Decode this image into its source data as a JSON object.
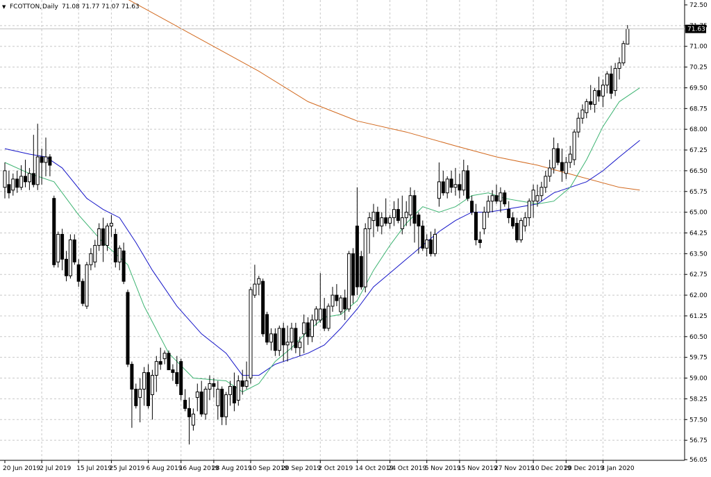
{
  "header": {
    "arrow": "▼",
    "symbol": "FCOTTON,",
    "timeframe": "Daily",
    "ohlc": "71.08 71.77 71.07 71.63"
  },
  "price_tag": "71.63",
  "colors": {
    "background": "#ffffff",
    "grid": "#c8c8c8",
    "bull_candle": "#ffffff",
    "bear_candle": "#000000",
    "candle_outline": "#000000",
    "ma_fast": "#3cb371",
    "ma_mid": "#1414c8",
    "ma_slow": "#d2691e",
    "price_tag_bg": "#000000",
    "price_tag_text": "#ffffff"
  },
  "chart_data": {
    "type": "candlestick",
    "title": "FCOTTON, Daily",
    "grid": true,
    "ylim": [
      56.05,
      72.5
    ],
    "y_ticks": [
      "72.50",
      "71.75",
      "71.00",
      "70.25",
      "69.50",
      "68.75",
      "68.00",
      "67.25",
      "66.50",
      "65.75",
      "65.00",
      "64.25",
      "63.50",
      "62.75",
      "62.00",
      "61.25",
      "60.50",
      "59.75",
      "59.00",
      "58.25",
      "57.50",
      "56.75",
      "56.05"
    ],
    "x_labels": [
      "20 Jun 2019",
      "2 Jul 2019",
      "15 Jul 2019",
      "25 Jul 2019",
      "6 Aug 2019",
      "16 Aug 2019",
      "28 Aug 2019",
      "10 Sep 2019",
      "20 Sep 2019",
      "2 Oct 2019",
      "14 Oct 2019",
      "24 Oct 2019",
      "5 Nov 2019",
      "15 Nov 2019",
      "27 Nov 2019",
      "10 Dec 2019",
      "20 Dec 2019",
      "3 Jan 2020"
    ],
    "x_label_bar_index": [
      0,
      9,
      18,
      26,
      35,
      43,
      51,
      60,
      68,
      77,
      86,
      94,
      103,
      111,
      120,
      129,
      137,
      146
    ],
    "last_price": 71.63,
    "candles": [
      {
        "o": 65.9,
        "h": 66.8,
        "l": 65.5,
        "c": 66.5
      },
      {
        "o": 66.0,
        "h": 66.5,
        "l": 65.5,
        "c": 65.7
      },
      {
        "o": 65.8,
        "h": 66.4,
        "l": 65.6,
        "c": 66.2
      },
      {
        "o": 66.2,
        "h": 66.5,
        "l": 65.7,
        "c": 65.9
      },
      {
        "o": 65.9,
        "h": 66.7,
        "l": 65.8,
        "c": 66.3
      },
      {
        "o": 66.3,
        "h": 66.9,
        "l": 65.9,
        "c": 66.1
      },
      {
        "o": 66.1,
        "h": 66.6,
        "l": 65.8,
        "c": 66.4
      },
      {
        "o": 66.4,
        "h": 67.8,
        "l": 65.9,
        "c": 66.0
      },
      {
        "o": 66.0,
        "h": 68.2,
        "l": 65.8,
        "c": 67.0
      },
      {
        "o": 67.0,
        "h": 67.3,
        "l": 66.0,
        "c": 66.8
      },
      {
        "o": 66.8,
        "h": 67.7,
        "l": 66.3,
        "c": 67.0
      },
      {
        "o": 67.0,
        "h": 67.1,
        "l": 66.3,
        "c": 66.7
      },
      {
        "o": 65.5,
        "h": 65.6,
        "l": 63.0,
        "c": 63.1
      },
      {
        "o": 63.2,
        "h": 64.3,
        "l": 63.0,
        "c": 64.2
      },
      {
        "o": 64.2,
        "h": 64.4,
        "l": 62.9,
        "c": 63.3
      },
      {
        "o": 63.3,
        "h": 63.6,
        "l": 62.5,
        "c": 62.7
      },
      {
        "o": 62.7,
        "h": 64.2,
        "l": 62.6,
        "c": 64.0
      },
      {
        "o": 64.0,
        "h": 64.2,
        "l": 63.1,
        "c": 63.2
      },
      {
        "o": 63.1,
        "h": 63.3,
        "l": 62.3,
        "c": 62.5
      },
      {
        "o": 62.5,
        "h": 62.6,
        "l": 61.6,
        "c": 61.7
      },
      {
        "o": 61.6,
        "h": 63.2,
        "l": 61.5,
        "c": 63.1
      },
      {
        "o": 63.1,
        "h": 63.7,
        "l": 62.9,
        "c": 63.5
      },
      {
        "o": 63.2,
        "h": 64.0,
        "l": 63.0,
        "c": 63.8
      },
      {
        "o": 63.8,
        "h": 64.6,
        "l": 63.6,
        "c": 64.4
      },
      {
        "o": 64.4,
        "h": 64.8,
        "l": 63.2,
        "c": 63.8
      },
      {
        "o": 63.8,
        "h": 64.6,
        "l": 63.6,
        "c": 64.5
      },
      {
        "o": 64.5,
        "h": 64.9,
        "l": 64.1,
        "c": 64.6
      },
      {
        "o": 64.2,
        "h": 64.4,
        "l": 63.0,
        "c": 63.2
      },
      {
        "o": 63.2,
        "h": 63.8,
        "l": 62.9,
        "c": 63.7
      },
      {
        "o": 63.6,
        "h": 63.9,
        "l": 62.4,
        "c": 62.5
      },
      {
        "o": 62.1,
        "h": 62.2,
        "l": 59.4,
        "c": 59.5
      },
      {
        "o": 59.5,
        "h": 59.6,
        "l": 57.2,
        "c": 58.6
      },
      {
        "o": 58.6,
        "h": 58.8,
        "l": 57.9,
        "c": 58.0
      },
      {
        "o": 58.3,
        "h": 59.0,
        "l": 57.4,
        "c": 58.6
      },
      {
        "o": 58.6,
        "h": 59.4,
        "l": 58.0,
        "c": 59.2
      },
      {
        "o": 59.2,
        "h": 59.5,
        "l": 57.9,
        "c": 58.0
      },
      {
        "o": 58.4,
        "h": 59.3,
        "l": 57.5,
        "c": 59.1
      },
      {
        "o": 59.1,
        "h": 59.8,
        "l": 58.5,
        "c": 59.6
      },
      {
        "o": 59.6,
        "h": 60.1,
        "l": 59.3,
        "c": 59.5
      },
      {
        "o": 59.7,
        "h": 60.0,
        "l": 59.5,
        "c": 59.9
      },
      {
        "o": 59.9,
        "h": 60.0,
        "l": 59.3,
        "c": 59.3
      },
      {
        "o": 59.3,
        "h": 59.5,
        "l": 58.9,
        "c": 59.2
      },
      {
        "o": 59.2,
        "h": 59.8,
        "l": 58.7,
        "c": 58.8
      },
      {
        "o": 59.6,
        "h": 59.7,
        "l": 58.2,
        "c": 58.4
      },
      {
        "o": 58.2,
        "h": 58.6,
        "l": 57.8,
        "c": 57.9
      },
      {
        "o": 57.9,
        "h": 58.3,
        "l": 56.6,
        "c": 57.6
      },
      {
        "o": 57.3,
        "h": 57.9,
        "l": 57.1,
        "c": 57.7
      },
      {
        "o": 58.3,
        "h": 58.8,
        "l": 57.8,
        "c": 58.5
      },
      {
        "o": 58.5,
        "h": 58.9,
        "l": 57.6,
        "c": 57.7
      },
      {
        "o": 57.7,
        "h": 58.7,
        "l": 57.5,
        "c": 58.6
      },
      {
        "o": 58.6,
        "h": 59.1,
        "l": 58.2,
        "c": 58.8
      },
      {
        "o": 58.8,
        "h": 59.0,
        "l": 58.3,
        "c": 58.7
      },
      {
        "o": 58.0,
        "h": 58.9,
        "l": 57.5,
        "c": 58.6
      },
      {
        "o": 58.6,
        "h": 58.7,
        "l": 57.3,
        "c": 57.6
      },
      {
        "o": 57.6,
        "h": 58.5,
        "l": 57.3,
        "c": 58.4
      },
      {
        "o": 58.4,
        "h": 58.9,
        "l": 58.0,
        "c": 58.7
      },
      {
        "o": 58.7,
        "h": 59.2,
        "l": 57.8,
        "c": 58.1
      },
      {
        "o": 58.2,
        "h": 59.1,
        "l": 58.0,
        "c": 58.9
      },
      {
        "o": 58.9,
        "h": 59.3,
        "l": 58.4,
        "c": 58.7
      },
      {
        "o": 58.7,
        "h": 59.6,
        "l": 58.6,
        "c": 58.9
      },
      {
        "o": 59.0,
        "h": 62.3,
        "l": 58.8,
        "c": 62.2
      },
      {
        "o": 62.0,
        "h": 63.1,
        "l": 61.9,
        "c": 62.4
      },
      {
        "o": 62.4,
        "h": 62.7,
        "l": 62.0,
        "c": 62.6
      },
      {
        "o": 62.5,
        "h": 62.6,
        "l": 60.5,
        "c": 60.6
      },
      {
        "o": 61.3,
        "h": 61.4,
        "l": 60.2,
        "c": 60.3
      },
      {
        "o": 60.3,
        "h": 60.8,
        "l": 60.0,
        "c": 60.6
      },
      {
        "o": 60.6,
        "h": 60.8,
        "l": 59.8,
        "c": 60.0
      },
      {
        "o": 60.0,
        "h": 60.9,
        "l": 59.8,
        "c": 60.8
      },
      {
        "o": 60.8,
        "h": 61.0,
        "l": 59.6,
        "c": 60.2
      },
      {
        "o": 60.2,
        "h": 60.9,
        "l": 59.6,
        "c": 60.3
      },
      {
        "o": 60.3,
        "h": 61.0,
        "l": 60.0,
        "c": 60.8
      },
      {
        "o": 60.8,
        "h": 61.0,
        "l": 59.9,
        "c": 60.1
      },
      {
        "o": 60.1,
        "h": 60.5,
        "l": 59.8,
        "c": 60.3
      },
      {
        "o": 60.6,
        "h": 61.3,
        "l": 59.9,
        "c": 61.0
      },
      {
        "o": 61.0,
        "h": 61.2,
        "l": 60.2,
        "c": 60.5
      },
      {
        "o": 60.5,
        "h": 61.3,
        "l": 60.3,
        "c": 61.1
      },
      {
        "o": 61.1,
        "h": 61.6,
        "l": 60.9,
        "c": 61.5
      },
      {
        "o": 61.1,
        "h": 62.8,
        "l": 61.0,
        "c": 61.5
      },
      {
        "o": 61.5,
        "h": 61.9,
        "l": 60.7,
        "c": 60.8
      },
      {
        "o": 60.8,
        "h": 61.7,
        "l": 60.7,
        "c": 61.6
      },
      {
        "o": 61.6,
        "h": 62.3,
        "l": 61.4,
        "c": 62.0
      },
      {
        "o": 62.0,
        "h": 62.4,
        "l": 61.6,
        "c": 61.8
      },
      {
        "o": 61.4,
        "h": 62.0,
        "l": 61.3,
        "c": 61.9
      },
      {
        "o": 61.9,
        "h": 62.2,
        "l": 61.1,
        "c": 61.5
      },
      {
        "o": 61.5,
        "h": 63.6,
        "l": 61.4,
        "c": 63.5
      },
      {
        "o": 63.5,
        "h": 63.7,
        "l": 61.7,
        "c": 62.0
      },
      {
        "o": 64.5,
        "h": 65.9,
        "l": 62.0,
        "c": 62.3
      },
      {
        "o": 63.4,
        "h": 63.6,
        "l": 62.2,
        "c": 62.3
      },
      {
        "o": 62.3,
        "h": 64.6,
        "l": 62.1,
        "c": 64.4
      },
      {
        "o": 64.4,
        "h": 65.0,
        "l": 63.5,
        "c": 64.8
      },
      {
        "o": 64.7,
        "h": 65.3,
        "l": 64.1,
        "c": 65.0
      },
      {
        "o": 65.0,
        "h": 65.2,
        "l": 64.3,
        "c": 64.5
      },
      {
        "o": 64.5,
        "h": 65.0,
        "l": 64.2,
        "c": 64.8
      },
      {
        "o": 64.8,
        "h": 65.5,
        "l": 64.5,
        "c": 64.6
      },
      {
        "o": 64.6,
        "h": 64.9,
        "l": 64.4,
        "c": 64.8
      },
      {
        "o": 64.8,
        "h": 65.4,
        "l": 64.5,
        "c": 65.1
      },
      {
        "o": 65.1,
        "h": 65.5,
        "l": 64.6,
        "c": 64.7
      },
      {
        "o": 64.4,
        "h": 65.6,
        "l": 64.2,
        "c": 64.8
      },
      {
        "o": 64.8,
        "h": 65.4,
        "l": 64.5,
        "c": 65.0
      },
      {
        "o": 64.9,
        "h": 65.9,
        "l": 64.5,
        "c": 65.6
      },
      {
        "o": 65.6,
        "h": 65.8,
        "l": 63.9,
        "c": 64.6
      },
      {
        "o": 64.9,
        "h": 65.0,
        "l": 63.5,
        "c": 64.5
      },
      {
        "o": 64.5,
        "h": 64.7,
        "l": 63.6,
        "c": 63.7
      },
      {
        "o": 63.7,
        "h": 64.2,
        "l": 63.4,
        "c": 64.0
      },
      {
        "o": 64.0,
        "h": 64.3,
        "l": 63.4,
        "c": 63.5
      },
      {
        "o": 63.5,
        "h": 64.4,
        "l": 63.4,
        "c": 64.2
      },
      {
        "o": 65.5,
        "h": 66.8,
        "l": 65.2,
        "c": 66.1
      },
      {
        "o": 66.1,
        "h": 66.5,
        "l": 65.6,
        "c": 65.7
      },
      {
        "o": 65.7,
        "h": 66.3,
        "l": 65.5,
        "c": 66.2
      },
      {
        "o": 66.2,
        "h": 66.5,
        "l": 65.7,
        "c": 65.9
      },
      {
        "o": 65.9,
        "h": 66.6,
        "l": 65.6,
        "c": 66.0
      },
      {
        "o": 66.0,
        "h": 66.4,
        "l": 65.5,
        "c": 65.8
      },
      {
        "o": 65.8,
        "h": 66.9,
        "l": 65.6,
        "c": 66.5
      },
      {
        "o": 66.5,
        "h": 66.7,
        "l": 65.4,
        "c": 65.5
      },
      {
        "o": 65.4,
        "h": 65.6,
        "l": 64.9,
        "c": 65.0
      },
      {
        "o": 65.0,
        "h": 65.3,
        "l": 63.8,
        "c": 64.0
      },
      {
        "o": 64.0,
        "h": 64.3,
        "l": 63.7,
        "c": 63.9
      },
      {
        "o": 64.4,
        "h": 65.2,
        "l": 64.2,
        "c": 65.0
      },
      {
        "o": 65.0,
        "h": 65.6,
        "l": 64.8,
        "c": 65.4
      },
      {
        "o": 65.4,
        "h": 65.8,
        "l": 65.0,
        "c": 65.6
      },
      {
        "o": 65.6,
        "h": 66.0,
        "l": 65.3,
        "c": 65.4
      },
      {
        "o": 65.4,
        "h": 65.9,
        "l": 65.0,
        "c": 65.7
      },
      {
        "o": 65.7,
        "h": 65.8,
        "l": 65.2,
        "c": 65.3
      },
      {
        "o": 65.1,
        "h": 65.4,
        "l": 64.6,
        "c": 64.8
      },
      {
        "o": 64.8,
        "h": 65.0,
        "l": 64.4,
        "c": 64.5
      },
      {
        "o": 64.6,
        "h": 64.8,
        "l": 63.9,
        "c": 64.0
      },
      {
        "o": 64.0,
        "h": 64.8,
        "l": 63.9,
        "c": 64.7
      },
      {
        "o": 64.5,
        "h": 65.0,
        "l": 64.3,
        "c": 64.8
      },
      {
        "o": 64.8,
        "h": 65.5,
        "l": 64.5,
        "c": 65.4
      },
      {
        "o": 65.4,
        "h": 66.0,
        "l": 64.8,
        "c": 65.8
      },
      {
        "o": 65.4,
        "h": 66.0,
        "l": 65.2,
        "c": 65.6
      },
      {
        "o": 65.6,
        "h": 66.1,
        "l": 65.4,
        "c": 65.9
      },
      {
        "o": 65.9,
        "h": 66.5,
        "l": 65.7,
        "c": 66.3
      },
      {
        "o": 66.3,
        "h": 66.9,
        "l": 66.1,
        "c": 66.6
      },
      {
        "o": 66.6,
        "h": 67.7,
        "l": 66.4,
        "c": 67.3
      },
      {
        "o": 67.3,
        "h": 67.5,
        "l": 66.7,
        "c": 66.8
      },
      {
        "o": 66.8,
        "h": 67.3,
        "l": 66.1,
        "c": 66.5
      },
      {
        "o": 66.4,
        "h": 67.0,
        "l": 66.2,
        "c": 66.8
      },
      {
        "o": 66.8,
        "h": 67.4,
        "l": 66.6,
        "c": 67.1
      },
      {
        "o": 66.9,
        "h": 68.0,
        "l": 66.7,
        "c": 67.9
      },
      {
        "o": 67.9,
        "h": 68.6,
        "l": 67.7,
        "c": 68.4
      },
      {
        "o": 68.4,
        "h": 68.9,
        "l": 68.2,
        "c": 68.7
      },
      {
        "o": 68.6,
        "h": 69.1,
        "l": 68.4,
        "c": 69.0
      },
      {
        "o": 69.0,
        "h": 69.6,
        "l": 68.7,
        "c": 68.9
      },
      {
        "o": 68.9,
        "h": 69.5,
        "l": 68.6,
        "c": 69.4
      },
      {
        "o": 69.4,
        "h": 69.9,
        "l": 69.0,
        "c": 69.2
      },
      {
        "o": 69.2,
        "h": 69.8,
        "l": 68.8,
        "c": 69.6
      },
      {
        "o": 69.6,
        "h": 70.1,
        "l": 69.3,
        "c": 70.0
      },
      {
        "o": 70.0,
        "h": 70.3,
        "l": 69.1,
        "c": 69.3
      },
      {
        "o": 69.4,
        "h": 70.4,
        "l": 69.2,
        "c": 70.2
      },
      {
        "o": 70.2,
        "h": 70.6,
        "l": 69.8,
        "c": 70.4
      },
      {
        "o": 70.4,
        "h": 71.2,
        "l": 70.3,
        "c": 71.1
      },
      {
        "o": 71.08,
        "h": 71.77,
        "l": 71.07,
        "c": 71.63
      }
    ],
    "ma_fast_points": [
      [
        0,
        66.8
      ],
      [
        6,
        66.4
      ],
      [
        12,
        66.1
      ],
      [
        18,
        64.9
      ],
      [
        24,
        63.9
      ],
      [
        30,
        63.1
      ],
      [
        34,
        61.6
      ],
      [
        40,
        59.9
      ],
      [
        46,
        59.0
      ],
      [
        54,
        58.9
      ],
      [
        58,
        58.5
      ],
      [
        62,
        58.8
      ],
      [
        66,
        59.6
      ],
      [
        70,
        60.1
      ],
      [
        74,
        60.7
      ],
      [
        78,
        61.2
      ],
      [
        82,
        61.3
      ],
      [
        86,
        61.8
      ],
      [
        90,
        62.9
      ],
      [
        94,
        63.8
      ],
      [
        98,
        64.6
      ],
      [
        102,
        65.2
      ],
      [
        106,
        65.0
      ],
      [
        110,
        65.2
      ],
      [
        114,
        65.6
      ],
      [
        118,
        65.7
      ],
      [
        122,
        65.5
      ],
      [
        126,
        65.4
      ],
      [
        130,
        65.3
      ],
      [
        134,
        65.4
      ],
      [
        138,
        65.9
      ],
      [
        142,
        66.9
      ],
      [
        146,
        68.1
      ],
      [
        150,
        69.0
      ],
      [
        155,
        69.5
      ]
    ],
    "ma_mid_points": [
      [
        0,
        67.3
      ],
      [
        6,
        67.1
      ],
      [
        10,
        67.0
      ],
      [
        14,
        66.6
      ],
      [
        20,
        65.5
      ],
      [
        24,
        65.1
      ],
      [
        28,
        64.8
      ],
      [
        32,
        63.9
      ],
      [
        36,
        62.9
      ],
      [
        42,
        61.6
      ],
      [
        48,
        60.6
      ],
      [
        54,
        59.9
      ],
      [
        58,
        59.1
      ],
      [
        62,
        59.1
      ],
      [
        66,
        59.5
      ],
      [
        70,
        59.7
      ],
      [
        74,
        59.9
      ],
      [
        78,
        60.2
      ],
      [
        82,
        60.8
      ],
      [
        86,
        61.5
      ],
      [
        90,
        62.3
      ],
      [
        94,
        62.8
      ],
      [
        98,
        63.3
      ],
      [
        102,
        63.8
      ],
      [
        106,
        64.3
      ],
      [
        110,
        64.7
      ],
      [
        114,
        65.0
      ],
      [
        118,
        65.0
      ],
      [
        122,
        65.1
      ],
      [
        126,
        65.2
      ],
      [
        130,
        65.3
      ],
      [
        134,
        65.7
      ],
      [
        138,
        65.9
      ],
      [
        142,
        66.1
      ],
      [
        146,
        66.5
      ],
      [
        150,
        67.0
      ],
      [
        155,
        67.6
      ]
    ],
    "ma_slow_points": [
      [
        0,
        74.9
      ],
      [
        14,
        73.9
      ],
      [
        30,
        72.7
      ],
      [
        46,
        71.4
      ],
      [
        62,
        70.1
      ],
      [
        74,
        69.0
      ],
      [
        86,
        68.3
      ],
      [
        98,
        67.9
      ],
      [
        110,
        67.4
      ],
      [
        120,
        67.0
      ],
      [
        130,
        66.7
      ],
      [
        140,
        66.3
      ],
      [
        150,
        65.9
      ],
      [
        155,
        65.8
      ]
    ]
  }
}
